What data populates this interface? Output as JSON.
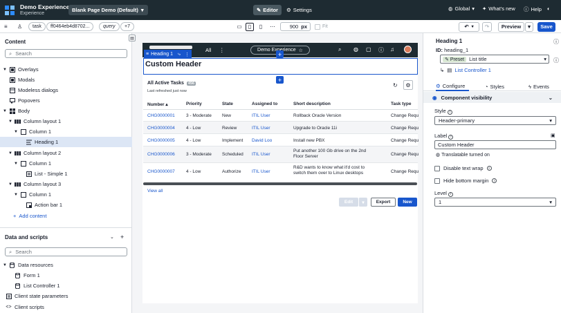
{
  "topbar": {
    "title": "Demo Experience",
    "subtitle": "Experience",
    "page_selector": "Blank Page Demo (Default)",
    "editor": "Editor",
    "settings": "Settings",
    "global": "Global",
    "whats_new": "What's new",
    "help": "Help"
  },
  "toolbar": {
    "chips": [
      "task",
      "ff0464eb4d8702...",
      "query",
      "+7"
    ],
    "width_value": "900",
    "width_unit": "px",
    "fit": "Fit",
    "preview": "Preview",
    "save": "Save"
  },
  "content_panel": {
    "title": "Content",
    "search_placeholder": "Search",
    "tree": [
      {
        "label": "Overlays"
      },
      {
        "label": "Modals"
      },
      {
        "label": "Modeless dialogs"
      },
      {
        "label": "Popovers"
      },
      {
        "label": "Body"
      },
      {
        "label": "Column layout 1"
      },
      {
        "label": "Column 1"
      },
      {
        "label": "Heading 1"
      },
      {
        "label": "Column layout 2"
      },
      {
        "label": "Column 1"
      },
      {
        "label": "List - Simple 1"
      },
      {
        "label": "Column layout 3"
      },
      {
        "label": "Column 1"
      },
      {
        "label": "Action bar 1"
      }
    ],
    "add_content": "Add content"
  },
  "data_panel": {
    "title": "Data and scripts",
    "search_placeholder": "Search",
    "tree": [
      {
        "label": "Data resources"
      },
      {
        "label": "Form 1"
      },
      {
        "label": "List Controller 1"
      },
      {
        "label": "Client state parameters"
      },
      {
        "label": "Client scripts"
      }
    ]
  },
  "canvas": {
    "nav_all": "All",
    "nav_pill": "Demo Experience",
    "heading_tag": "Heading 1",
    "heading_text": "Custom Header",
    "list": {
      "title": "All Active Tasks",
      "count": "456",
      "subtitle": "Last refreshed just now",
      "columns": [
        "Number",
        "Priority",
        "State",
        "Assigned to",
        "Short description",
        "Task type"
      ],
      "rows": [
        {
          "number": "CHG0000001",
          "priority": "3 - Moderate",
          "state": "New",
          "assigned": "ITIL User",
          "desc": "Rollback Oracle Version",
          "type": "Change Requ"
        },
        {
          "number": "CHG0000004",
          "priority": "4 - Low",
          "state": "Review",
          "assigned": "ITIL User",
          "desc": "Upgrade to Oracle 11i",
          "type": "Change Requ"
        },
        {
          "number": "CHG0000005",
          "priority": "4 - Low",
          "state": "Implement",
          "assigned": "David Loo",
          "desc": "Install new PBX",
          "type": "Change Requ"
        },
        {
          "number": "CHG0000006",
          "priority": "3 - Moderate",
          "state": "Scheduled",
          "assigned": "ITIL User",
          "desc": "Put another 100 Gb drive on the 2nd Floor Server",
          "type": "Change Requ"
        },
        {
          "number": "CHG0000007",
          "priority": "4 - Low",
          "state": "Authorize",
          "assigned": "ITIL User",
          "desc": "R&D wants to know what it'd cost to switch them over to Linux desktops",
          "type": "Change Requ"
        }
      ],
      "view_all": "View all",
      "edit": "Edit",
      "export": "Export",
      "new": "New"
    }
  },
  "right_panel": {
    "title": "Heading 1",
    "id_label": "ID:",
    "id_value": "heading_1",
    "preset_label": "Preset",
    "preset_value": "List title",
    "controller": "List Controller 1",
    "tabs": [
      "Configure",
      "Styles",
      "Events"
    ],
    "section": "Component visibility",
    "style_label": "Style",
    "style_value": "Header-primary",
    "label_label": "Label",
    "label_value": "Custom Header",
    "translatable": "Translatable turned on",
    "disable_wrap": "Disable text wrap",
    "hide_margin": "Hide bottom margin",
    "level_label": "Level",
    "level_value": "1"
  },
  "colors": {
    "accent": "#1856cc",
    "topbar": "#1e2b32",
    "selected_row": "#dce6f5"
  }
}
